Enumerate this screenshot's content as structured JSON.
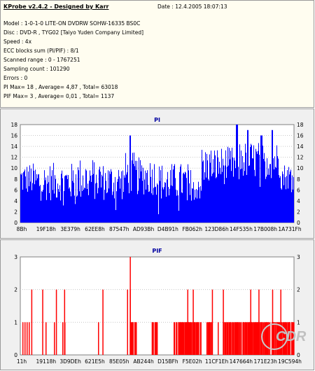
{
  "info": {
    "title": "KProbe v2.4.2 - Designed by Karr",
    "date": "Date : 12.4.2005 18:07:13",
    "lines": [
      "Model : 1-0-1-0 LITE-ON DVDRW SOHW-16335 BS0C",
      "Disc : DVD-R , TYG02 [Taiyo Yuden Company Limited]",
      "Speed : 4x",
      "ECC blocks sum (PI/PIF) : 8/1",
      "Scanned range : 0 - 1767251",
      "Sampling count : 101290",
      "Errors : 0",
      "PI Max= 18 , Average= 4,87 , Total= 63018",
      "PIF Max= 3 , Average= 0,01 , Total= 1137"
    ]
  },
  "watermark": "CDR",
  "chart_data": [
    {
      "type": "bar",
      "title": "PI",
      "color": "#0000ff",
      "ylim": [
        0,
        18
      ],
      "yticks": [
        0,
        2,
        4,
        6,
        8,
        10,
        12,
        14,
        16,
        18
      ],
      "grid": true,
      "xtick_labels": [
        "8Bh",
        "19F18h",
        "3E379h",
        "62EE8h",
        "87547h",
        "AD93Bh",
        "D4B91h",
        "FB062h",
        "123D86h",
        "14F535h",
        "17B008h",
        "1A731Fh"
      ],
      "segments": [
        {
          "from": 0.0,
          "to": 0.05,
          "min": 5,
          "max": 11
        },
        {
          "from": 0.05,
          "to": 0.2,
          "min": 4,
          "max": 11
        },
        {
          "from": 0.2,
          "to": 0.3,
          "min": 4,
          "max": 12
        },
        {
          "from": 0.3,
          "to": 0.38,
          "min": 4,
          "max": 11
        },
        {
          "from": 0.38,
          "to": 0.42,
          "min": 5,
          "max": 13
        },
        {
          "from": 0.42,
          "to": 0.5,
          "min": 5,
          "max": 12
        },
        {
          "from": 0.5,
          "to": 0.62,
          "min": 4,
          "max": 11
        },
        {
          "from": 0.62,
          "to": 0.66,
          "min": 4,
          "max": 10
        },
        {
          "from": 0.66,
          "to": 0.8,
          "min": 7,
          "max": 14
        },
        {
          "from": 0.8,
          "to": 0.95,
          "min": 8,
          "max": 15
        },
        {
          "from": 0.95,
          "to": 1.0,
          "min": 6,
          "max": 11
        }
      ],
      "peaks": [
        {
          "at": 0.4,
          "value": 16
        },
        {
          "at": 0.79,
          "value": 18
        },
        {
          "at": 0.83,
          "value": 17
        },
        {
          "at": 0.88,
          "value": 16
        },
        {
          "at": 0.92,
          "value": 17
        }
      ]
    },
    {
      "type": "bar",
      "title": "PIF",
      "color": "#ff0000",
      "ylim": [
        0,
        3
      ],
      "yticks": [
        0,
        1,
        2,
        3
      ],
      "grid": true,
      "xtick_labels": [
        "11h",
        "19118h",
        "3D9DEh",
        "621E5h",
        "85E05h",
        "AB244h",
        "D15BFh",
        "F5E02h",
        "11CF1Eh",
        "147664h",
        "171E23h",
        "19C594h"
      ],
      "twos": [
        0.04,
        0.08,
        0.13,
        0.16,
        0.3,
        0.39,
        0.4,
        0.61,
        0.63,
        0.7,
        0.74,
        0.84,
        0.87,
        0.92,
        0.95
      ],
      "threes": [
        0.4
      ],
      "dense": [
        {
          "from": 0.4,
          "to": 0.42
        },
        {
          "from": 0.48,
          "to": 0.5
        },
        {
          "from": 0.56,
          "to": 0.66
        },
        {
          "from": 0.68,
          "to": 0.7
        },
        {
          "from": 0.74,
          "to": 1.0
        }
      ]
    }
  ]
}
